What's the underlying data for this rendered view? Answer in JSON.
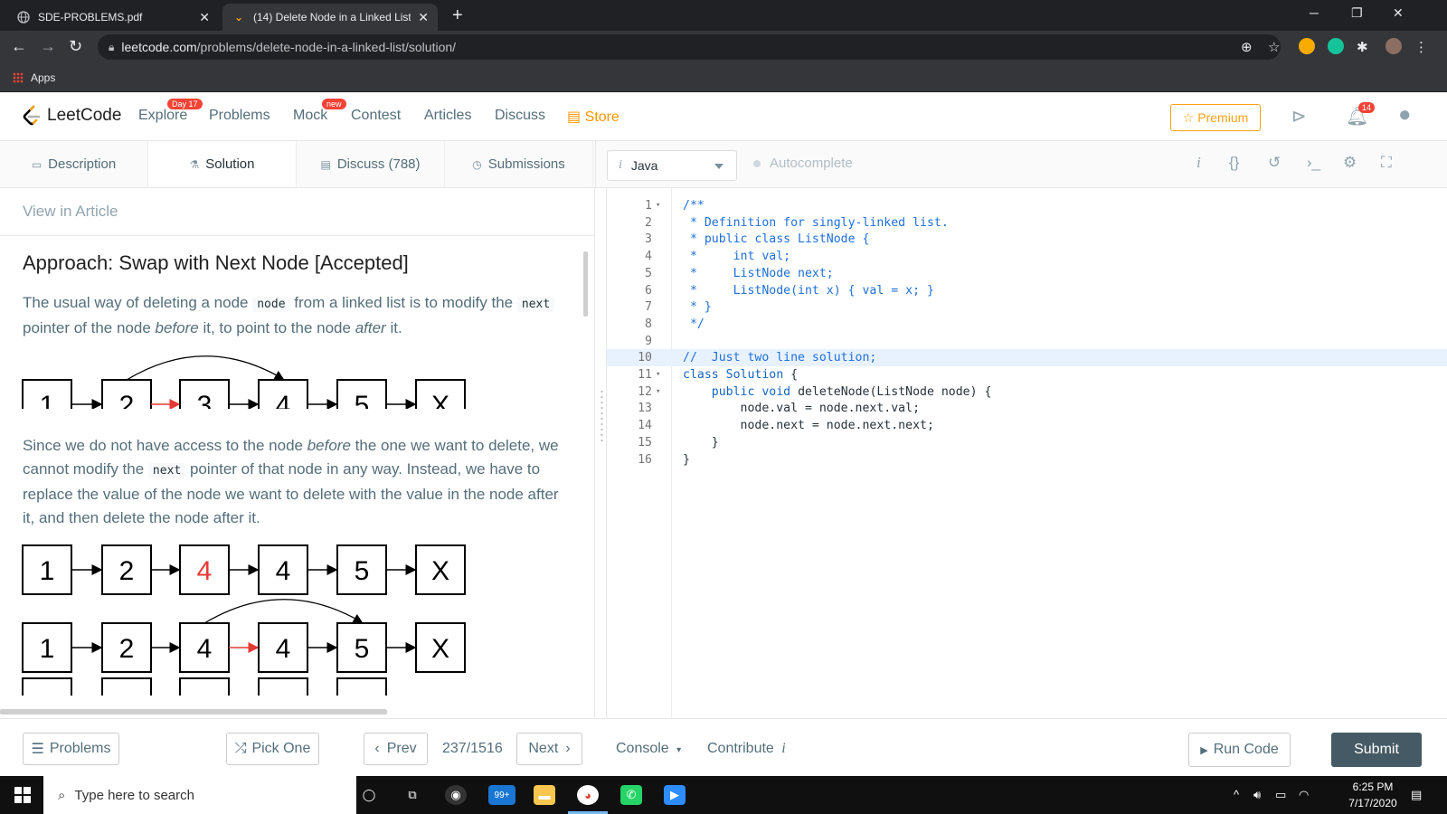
{
  "browser": {
    "tabs": [
      {
        "title": "SDE-PROBLEMS.pdf",
        "active": false
      },
      {
        "title": "(14) Delete Node in a Linked List",
        "active": true
      }
    ],
    "url_host": "leetcode.com",
    "url_path": "/problems/delete-node-in-a-linked-list/solution/",
    "bookmarks": {
      "apps_label": "Apps"
    }
  },
  "header": {
    "logo": "LeetCode",
    "nav": [
      {
        "label": "Explore",
        "badge": "Day 17"
      },
      {
        "label": "Problems",
        "badge": ""
      },
      {
        "label": "Mock",
        "badge": "new"
      },
      {
        "label": "Contest",
        "badge": ""
      },
      {
        "label": "Articles",
        "badge": ""
      },
      {
        "label": "Discuss",
        "badge": ""
      },
      {
        "label": "Store",
        "badge": ""
      }
    ],
    "premium": "Premium",
    "notification_count": "14"
  },
  "left_tabs": [
    {
      "label": "Description",
      "icon": "description-icon"
    },
    {
      "label": "Solution",
      "icon": "flask-icon"
    },
    {
      "label": "Discuss (788)",
      "icon": "comment-icon"
    },
    {
      "label": "Submissions",
      "icon": "clock-icon"
    }
  ],
  "article": {
    "view_in_article": "View in Article",
    "title": "Approach: Swap with Next Node [Accepted]",
    "p1": {
      "t1": "The usual way of deleting a node ",
      "code1": "node",
      "t2": " from a linked list is to modify the ",
      "code2": "next",
      "t3": " pointer of the node ",
      "em1": "before",
      "t4": " it, to point to the node ",
      "em2": "after",
      "t5": " it."
    },
    "p2": {
      "t1": "Since we do not have access to the node ",
      "em1": "before",
      "t2": " the one we want to delete, we cannot modify the ",
      "code1": "next",
      "t3": " pointer of that node in any way. Instead, we have to replace the value of the node we want to delete with the value in the node after it, and then delete the node after it."
    },
    "diagrams": [
      {
        "nodes": [
          "1",
          "2",
          "3",
          "4",
          "5",
          "X"
        ],
        "red_node": -1,
        "red_arrow": 1,
        "skip_from": 1,
        "skip_to": 3
      },
      {
        "nodes": [
          "1",
          "2",
          "4",
          "4",
          "5",
          "X"
        ],
        "red_node": 2,
        "red_arrow": -1,
        "skip_from": -1,
        "skip_to": -1
      },
      {
        "nodes": [
          "1",
          "2",
          "4",
          "4",
          "5",
          "X"
        ],
        "red_node": -1,
        "red_arrow": 2,
        "skip_from": 2,
        "skip_to": 4
      }
    ]
  },
  "editor": {
    "language": "Java",
    "language_icon_text": "i",
    "autocomplete": "Autocomplete",
    "tools": [
      "info-icon",
      "braces-icon",
      "reset-icon",
      "terminal-icon",
      "settings-icon",
      "fullscreen-icon"
    ],
    "lines": [
      {
        "n": "1",
        "fold": true,
        "text": "/**",
        "type": "comment"
      },
      {
        "n": "2",
        "fold": false,
        "text": " * Definition for singly-linked list.",
        "type": "comment"
      },
      {
        "n": "3",
        "fold": false,
        "text": " * public class ListNode {",
        "type": "comment"
      },
      {
        "n": "4",
        "fold": false,
        "text": " *     int val;",
        "type": "comment"
      },
      {
        "n": "5",
        "fold": false,
        "text": " *     ListNode next;",
        "type": "comment"
      },
      {
        "n": "6",
        "fold": false,
        "text": " *     ListNode(int x) { val = x; }",
        "type": "comment"
      },
      {
        "n": "7",
        "fold": false,
        "text": " * }",
        "type": "comment"
      },
      {
        "n": "8",
        "fold": false,
        "text": " */",
        "type": "comment"
      },
      {
        "n": "9",
        "fold": false,
        "text": "",
        "type": "code"
      },
      {
        "n": "10",
        "fold": false,
        "text": "//  Just two line solution;",
        "type": "comment",
        "highlight": true
      },
      {
        "n": "11",
        "fold": true,
        "text": "class Solution {",
        "type": "code"
      },
      {
        "n": "12",
        "fold": true,
        "text": "    public void deleteNode(ListNode node) {",
        "type": "code"
      },
      {
        "n": "13",
        "fold": false,
        "text": "        node.val = node.next.val;",
        "type": "code"
      },
      {
        "n": "14",
        "fold": false,
        "text": "        node.next = node.next.next;",
        "type": "code"
      },
      {
        "n": "15",
        "fold": false,
        "text": "    }",
        "type": "code"
      },
      {
        "n": "16",
        "fold": false,
        "text": "}",
        "type": "code"
      }
    ]
  },
  "bottom": {
    "problems": "Problems",
    "pick_one": "Pick One",
    "prev": "Prev",
    "counter": "237/1516",
    "next": "Next",
    "console": "Console",
    "contribute": "Contribute",
    "run_code": "Run Code",
    "submit": "Submit"
  },
  "taskbar": {
    "search_placeholder": "Type here to search",
    "mail_badge": "99+",
    "time": "6:25 PM",
    "date": "7/17/2020",
    "notif": "1"
  },
  "colors": {
    "accent_orange": "#ffa116",
    "red": "#f44336",
    "submit": "#455a64"
  }
}
